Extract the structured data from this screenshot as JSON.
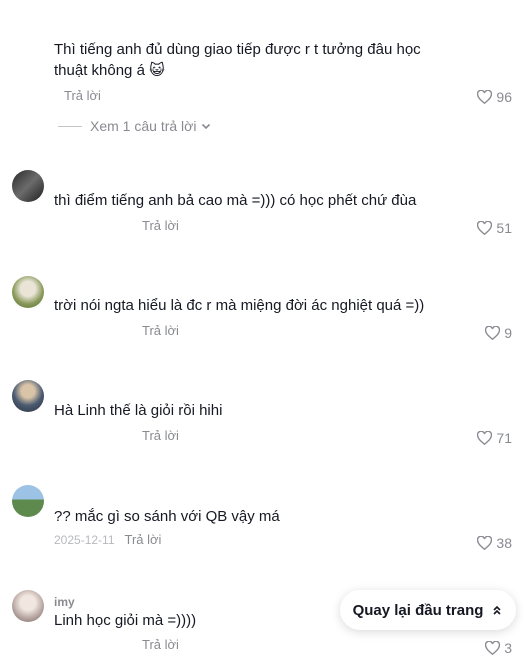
{
  "comments": [
    {
      "username": "",
      "text": "Thì tiếng anh đủ dùng giao tiếp được r t tưởng đâu học thuật không á",
      "emoji": "😺",
      "date": "",
      "reply_label": "Trả lời",
      "likes": "96"
    },
    {
      "username": "",
      "text": "thì điểm tiếng anh bả cao mà =))) có học phết chứ đùa",
      "date": "",
      "reply_label": "Trả lời",
      "likes": "51"
    },
    {
      "username": "",
      "text": "trời nói ngta hiểu là đc r mà miệng đời ác nghiệt quá =))",
      "date": "",
      "reply_label": "Trả lời",
      "likes": "9"
    },
    {
      "username": "",
      "text": "Hà Linh thế là giỏi rồi hihi",
      "date": "",
      "reply_label": "Trả lời",
      "likes": "71"
    },
    {
      "username": "",
      "text": "?? mắc gì so sánh với QB vậy má",
      "date": "2025-12-11",
      "reply_label": "Trả lời",
      "likes": "38"
    },
    {
      "username": "imy",
      "text": "Linh học giỏi mà =))))",
      "date": "",
      "reply_label": "Trả lời",
      "likes": "3"
    }
  ],
  "view_replies": "Xem 1 câu trả lời",
  "back_to_top": "Quay lại đầu trang",
  "colors": {
    "secondary_text": "#8a8b91",
    "primary_text": "#161823"
  }
}
